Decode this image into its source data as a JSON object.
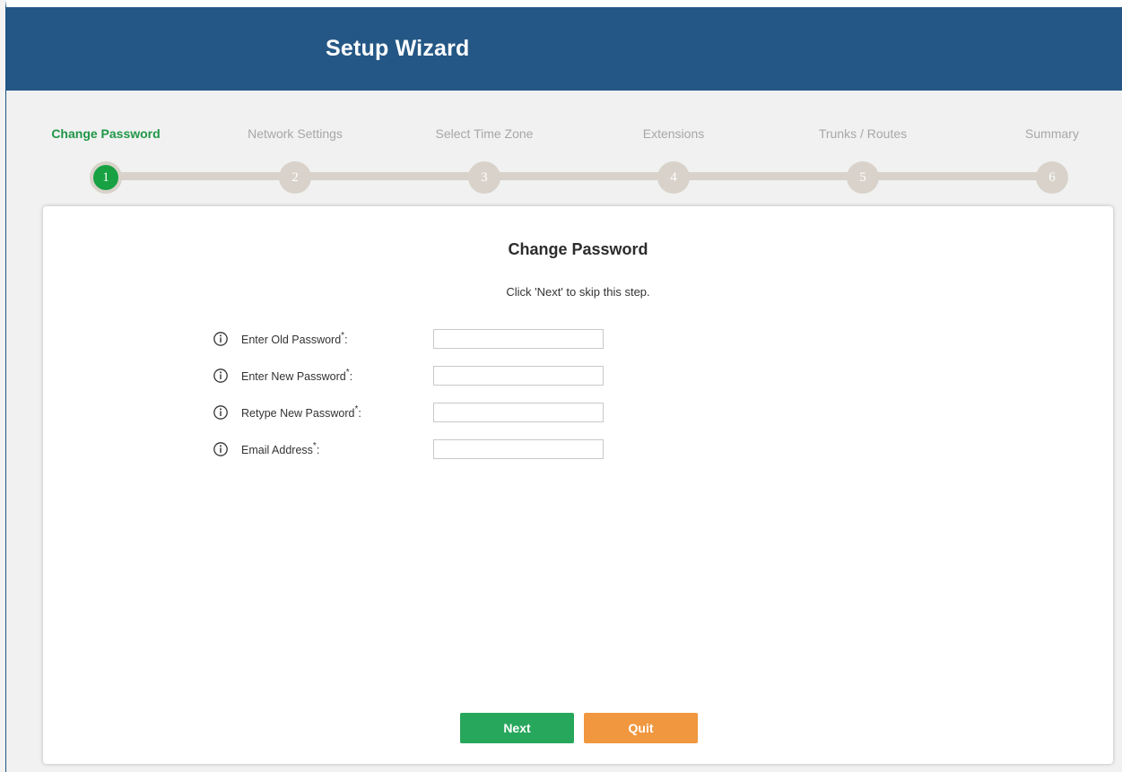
{
  "header": {
    "title": "Setup Wizard"
  },
  "steps": [
    {
      "label": "Change Password",
      "number": "1",
      "active": true
    },
    {
      "label": "Network Settings",
      "number": "2",
      "active": false
    },
    {
      "label": "Select Time Zone",
      "number": "3",
      "active": false
    },
    {
      "label": "Extensions",
      "number": "4",
      "active": false
    },
    {
      "label": "Trunks / Routes",
      "number": "5",
      "active": false
    },
    {
      "label": "Summary",
      "number": "6",
      "active": false
    }
  ],
  "form": {
    "title": "Change Password",
    "subtitle": "Click 'Next' to skip this step.",
    "fields": [
      {
        "label": "Enter Old Password",
        "required_mark": "*",
        "suffix": ":",
        "value": "",
        "icon": "info-icon"
      },
      {
        "label": "Enter New Password",
        "required_mark": "*",
        "suffix": ":",
        "value": "",
        "icon": "info-icon"
      },
      {
        "label": "Retype New Password",
        "required_mark": "*",
        "suffix": ":",
        "value": "",
        "icon": "info-icon"
      },
      {
        "label": "Email Address",
        "required_mark": "*",
        "suffix": ":",
        "value": "",
        "icon": "info-icon"
      }
    ]
  },
  "buttons": {
    "next_label": "Next",
    "quit_label": "Quit"
  },
  "colors": {
    "header_bg": "#245785",
    "active_step": "#219648",
    "inactive_step": "#a7a7a7",
    "track": "#d8d2ca",
    "next_button": "#27a75c",
    "quit_button": "#f0973f"
  }
}
